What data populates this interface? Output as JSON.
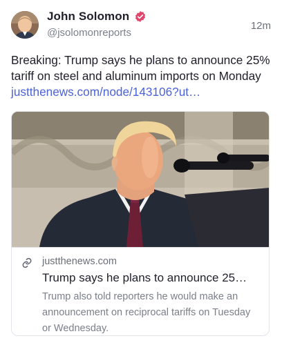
{
  "author": {
    "display_name": "John Solomon",
    "handle": "@jsolomonreports",
    "verified_badge_color": "#e0466b",
    "avatar_icon": "author-avatar"
  },
  "post": {
    "timestamp": "12m",
    "text": "Breaking: Trump says he plans to announce 25% tariff on steel and aluminum imports on Monday ",
    "link_text": "justthenews.com/node/143106?ut…",
    "link_color": "#4b62d8"
  },
  "card": {
    "domain": "justthenews.com",
    "title": "Trump says he plans to announce 25…",
    "description": "Trump also told reporters he would make an announcement on reciprocal tariffs on Tuesday or Wednesday.",
    "link_icon": "link-icon",
    "image_icon": "article-photo"
  }
}
